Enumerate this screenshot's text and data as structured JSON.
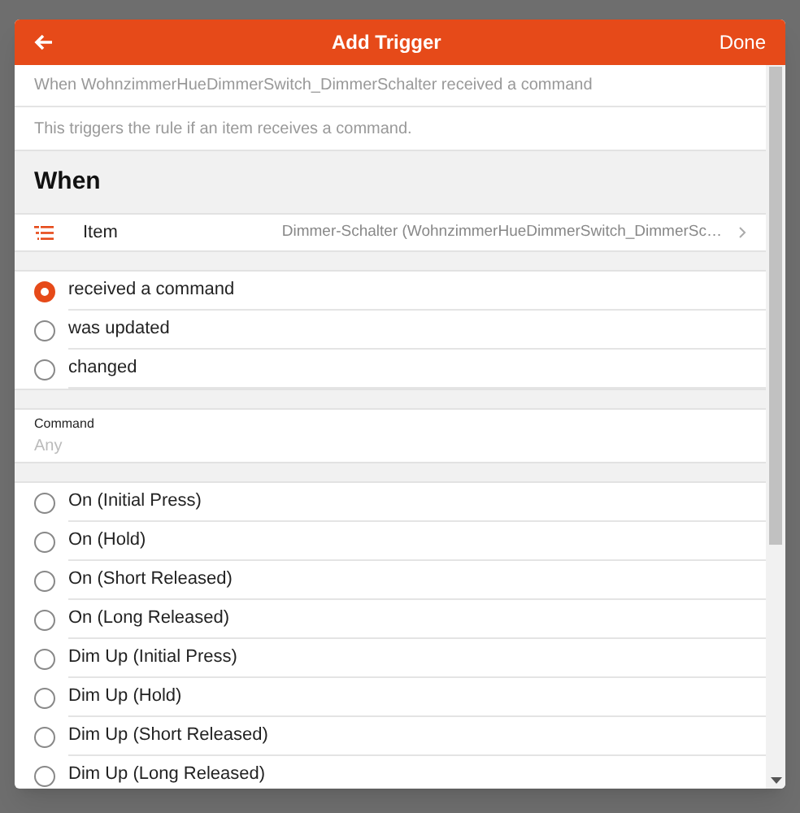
{
  "header": {
    "title": "Add Trigger",
    "done": "Done"
  },
  "summary": "When WohnzimmerHueDimmerSwitch_DimmerSchalter received a command",
  "description": "This triggers the rule if an item receives a command.",
  "section_title": "When",
  "item_row": {
    "label": "Item",
    "value": "Dimmer-Schalter (WohnzimmerHueDimmerSwitch_DimmerSc…"
  },
  "events": [
    {
      "label": "received a command",
      "selected": true
    },
    {
      "label": "was updated",
      "selected": false
    },
    {
      "label": "changed",
      "selected": false
    }
  ],
  "command_field": {
    "label": "Command",
    "placeholder": "Any"
  },
  "commands": [
    {
      "label": "On (Initial Press)",
      "selected": false
    },
    {
      "label": "On (Hold)",
      "selected": false
    },
    {
      "label": "On (Short Released)",
      "selected": false
    },
    {
      "label": "On (Long Released)",
      "selected": false
    },
    {
      "label": "Dim Up (Initial Press)",
      "selected": false
    },
    {
      "label": "Dim Up (Hold)",
      "selected": false
    },
    {
      "label": "Dim Up (Short Released)",
      "selected": false
    },
    {
      "label": "Dim Up (Long Released)",
      "selected": false
    }
  ]
}
